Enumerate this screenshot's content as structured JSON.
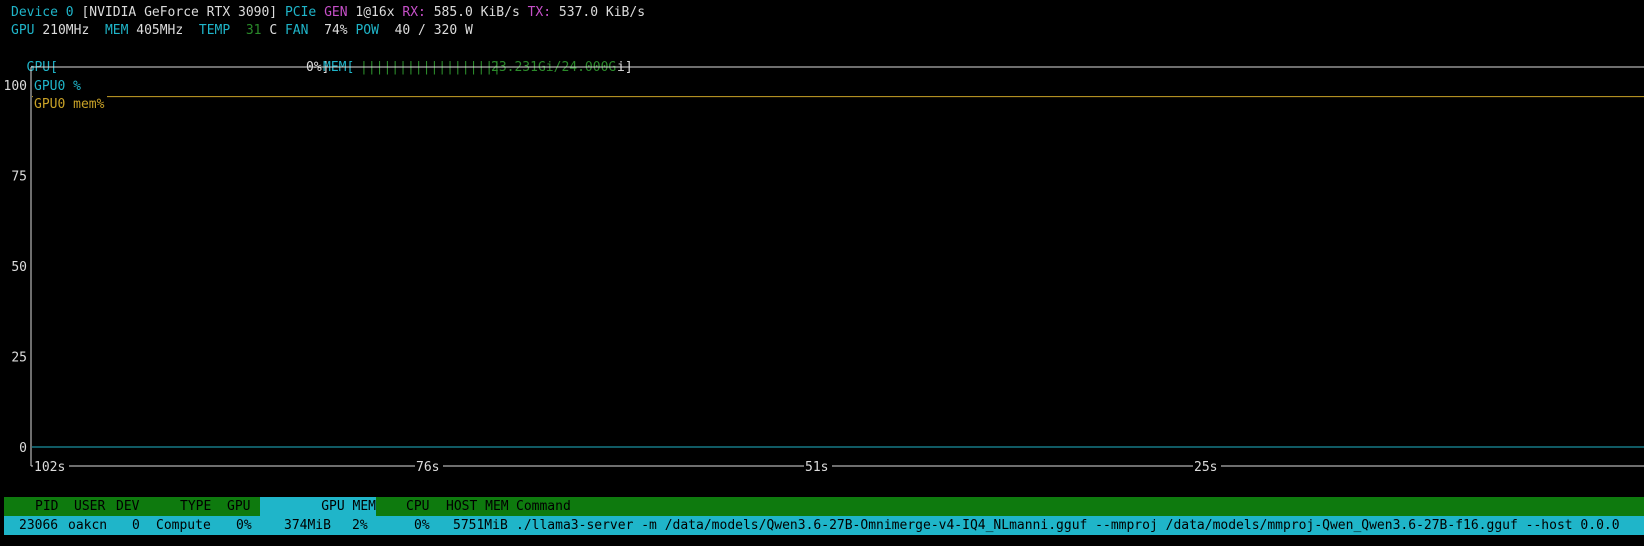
{
  "device": {
    "label": "Device 0",
    "name": "[NVIDIA GeForce RTX 3090]",
    "pcie_label": "PCIe",
    "gen_label": "GEN",
    "gen_value": "1@16x",
    "rx_label": "RX:",
    "rx_value": "585.0 KiB/s",
    "tx_label": "TX:",
    "tx_value": "537.0 KiB/s"
  },
  "clocks": {
    "gpu_label": "GPU",
    "gpu_value": "210MHz",
    "mem_label": "MEM",
    "mem_value": "405MHz",
    "temp_label": "TEMP",
    "temp_value": "31",
    "temp_unit": "C",
    "fan_label": "FAN",
    "fan_value": "74%",
    "pow_label": "POW",
    "pow_value": "40 / 320 W"
  },
  "bars": {
    "gpu_label": "GPU[",
    "gpu_value": "0%]",
    "gpu_fraction": 0.0,
    "mem_label": "MEM[",
    "mem_bars": "||||||||||||||||||",
    "mem_value": "23.231Gi/24.000G",
    "mem_suffix": "i]",
    "mem_fraction": 0.968
  },
  "chart_data": {
    "type": "line",
    "yticks": [
      "100",
      "75",
      "50",
      "25",
      "0"
    ],
    "ylim": [
      0,
      100
    ],
    "xticks": [
      "102s",
      "76s",
      "51s",
      "25s"
    ],
    "series": [
      {
        "name": "GPU0 %",
        "color": "#1fb5c9",
        "values": [
          0,
          0
        ]
      },
      {
        "name": "GPU0 mem%",
        "color": "#c9a227",
        "values": [
          96.8,
          96.8
        ]
      }
    ]
  },
  "table": {
    "headers": [
      "PID",
      "USER",
      "DEV",
      "TYPE",
      "GPU",
      "GPU MEM",
      "CPU",
      "HOST MEM",
      "Command"
    ],
    "rows": [
      {
        "pid": "23066",
        "user": "oakcn",
        "dev": "0",
        "type": "Compute",
        "gpu": "0%",
        "gpu_mem": "374MiB",
        "gpu_mem_pct": "2%",
        "cpu": "0%",
        "host_mem": "5751MiB",
        "command": "./llama3-server -m /data/models/Qwen3.6-27B-Omnimerge-v4-IQ4_NLmanni.gguf --mmproj /data/models/mmproj-Qwen_Qwen3.6-27B-f16.gguf --host 0.0.0"
      }
    ]
  }
}
